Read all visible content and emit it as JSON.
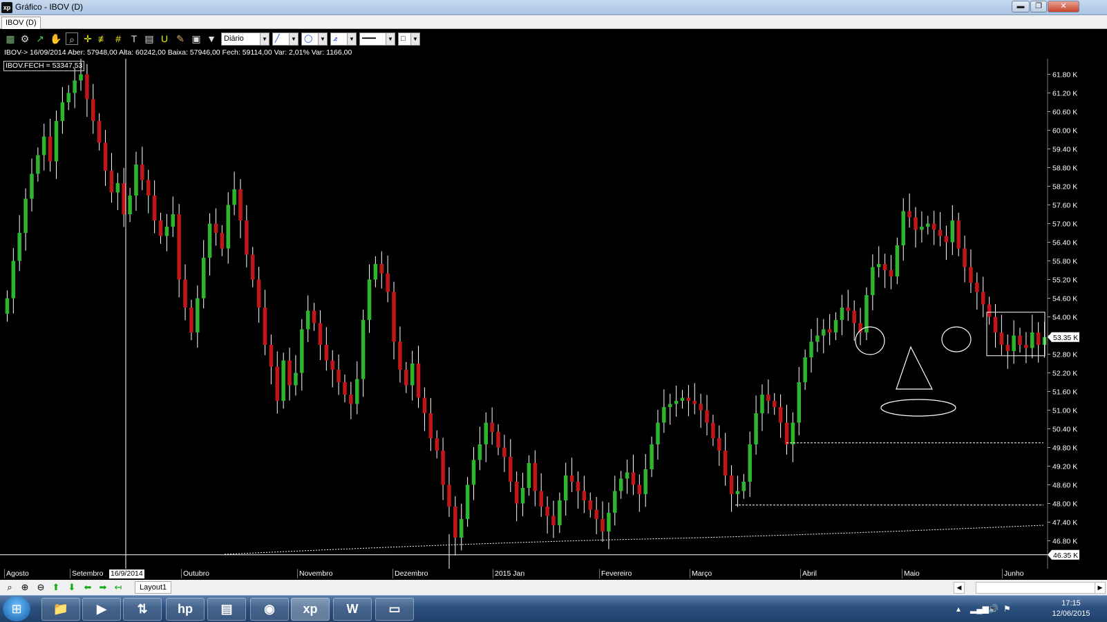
{
  "window": {
    "title": "Gráfico - IBOV (D)",
    "icon_text": "xp",
    "minimize": "▬",
    "restore": "❐",
    "close": "✕"
  },
  "tabs": [
    "IBOV (D)"
  ],
  "toolbar": {
    "period": "Diário",
    "icons": [
      "chart-type-icon",
      "settings-icon",
      "cursor-icon",
      "hand-icon",
      "zoom-icon",
      "crosshair-icon",
      "fibonacci-icon",
      "grid-icon",
      "text-icon",
      "calculator-icon",
      "magnet-icon",
      "brush-icon",
      "clipboard-icon",
      "filter-icon"
    ]
  },
  "info_line": "IBOV-> 16/09/2014 Aber: 57948,00 Alta: 60242,00 Baixa: 57946,00 Fech: 59114,00 Var: 2,01% Var: 1166,00",
  "legend": "IBOV.FECH = 53347,53",
  "date_flag": "16/9/2014",
  "colors": {
    "up": "#2db52d",
    "down": "#c0161a",
    "background": "#000000",
    "price_tag": "#ffffff"
  },
  "chart_data": {
    "type": "candlestick",
    "title": "IBOV (D)",
    "yticks": [
      "61.80 K",
      "61.20 K",
      "60.60 K",
      "60.00 K",
      "59.40 K",
      "58.80 K",
      "58.20 K",
      "57.60 K",
      "57.00 K",
      "56.40 K",
      "55.80 K",
      "55.20 K",
      "54.60 K",
      "54.00 K",
      "53.40 K",
      "52.80 K",
      "52.20 K",
      "51.60 K",
      "51.00 K",
      "50.40 K",
      "49.80 K",
      "49.20 K",
      "48.60 K",
      "48.00 K",
      "47.40 K",
      "46.80 K"
    ],
    "ylim": [
      45.9,
      62.3
    ],
    "last_price": "53.35 K",
    "last_value": 53.35,
    "low_marker": "46.35 K",
    "low_value": 46.35,
    "xlabels": [
      "Agosto",
      "Setembro",
      "Outubro",
      "Novembro",
      "Dezembro",
      "2015 Jan",
      "Fevereiro",
      "Março",
      "Abril",
      "Maio",
      "Junho"
    ],
    "support_levels": [
      49.95,
      47.95
    ],
    "range_box": [
      52.75,
      54.15
    ],
    "closes": [
      54.6,
      55.8,
      56.7,
      57.8,
      58.6,
      59.2,
      59.8,
      59.0,
      60.3,
      60.9,
      61.2,
      61.6,
      61.8,
      61.0,
      60.3,
      59.6,
      58.7,
      58.0,
      58.3,
      57.3,
      57.9,
      58.9,
      58.4,
      57.9,
      57.1,
      56.6,
      56.9,
      57.3,
      55.2,
      54.3,
      53.5,
      54.6,
      55.9,
      57.0,
      56.7,
      56.2,
      57.6,
      58.1,
      57.1,
      56.0,
      55.2,
      54.3,
      53.1,
      52.4,
      51.3,
      52.6,
      51.8,
      52.2,
      53.6,
      54.2,
      53.8,
      53.1,
      52.6,
      52.3,
      51.9,
      51.5,
      51.2,
      52.0,
      53.9,
      55.2,
      55.7,
      55.4,
      54.8,
      53.2,
      52.3,
      51.8,
      52.5,
      51.4,
      50.9,
      50.1,
      49.7,
      48.6,
      47.9,
      46.9,
      47.5,
      48.6,
      49.4,
      49.9,
      50.6,
      50.3,
      49.8,
      49.5,
      48.7,
      48.0,
      48.5,
      49.3,
      48.4,
      47.9,
      47.6,
      47.3,
      48.1,
      48.9,
      48.7,
      48.4,
      48.1,
      47.8,
      47.5,
      47.1,
      47.7,
      48.4,
      48.8,
      49.0,
      48.6,
      48.3,
      49.1,
      49.9,
      50.6,
      51.1,
      51.2,
      51.3,
      51.4,
      51.3,
      51.2,
      51.0,
      50.6,
      50.1,
      49.7,
      48.9,
      48.3,
      48.4,
      48.7,
      49.9,
      50.9,
      51.5,
      51.3,
      51.1,
      50.6,
      49.9,
      50.6,
      51.9,
      52.7,
      53.2,
      53.4,
      53.6,
      53.5,
      53.9,
      54.3,
      54.2,
      53.8,
      53.5,
      54.7,
      55.6,
      55.7,
      55.5,
      55.3,
      56.3,
      57.4,
      57.2,
      56.8,
      56.9,
      57.0,
      56.8,
      56.6,
      56.4,
      57.1,
      56.2,
      55.6,
      55.1,
      54.8,
      54.4,
      54.0,
      53.5,
      53.1,
      52.9,
      53.4,
      53.1,
      53.0,
      53.5,
      53.1,
      53.35
    ]
  },
  "annotations": {
    "shapes": [
      "left-eye-circle",
      "right-eye-circle",
      "nose-triangle",
      "mouth-ellipse"
    ]
  },
  "bottom": {
    "layout_tab": "Layout1"
  },
  "taskbar": {
    "time": "17:15",
    "date": "12/06/2015"
  }
}
